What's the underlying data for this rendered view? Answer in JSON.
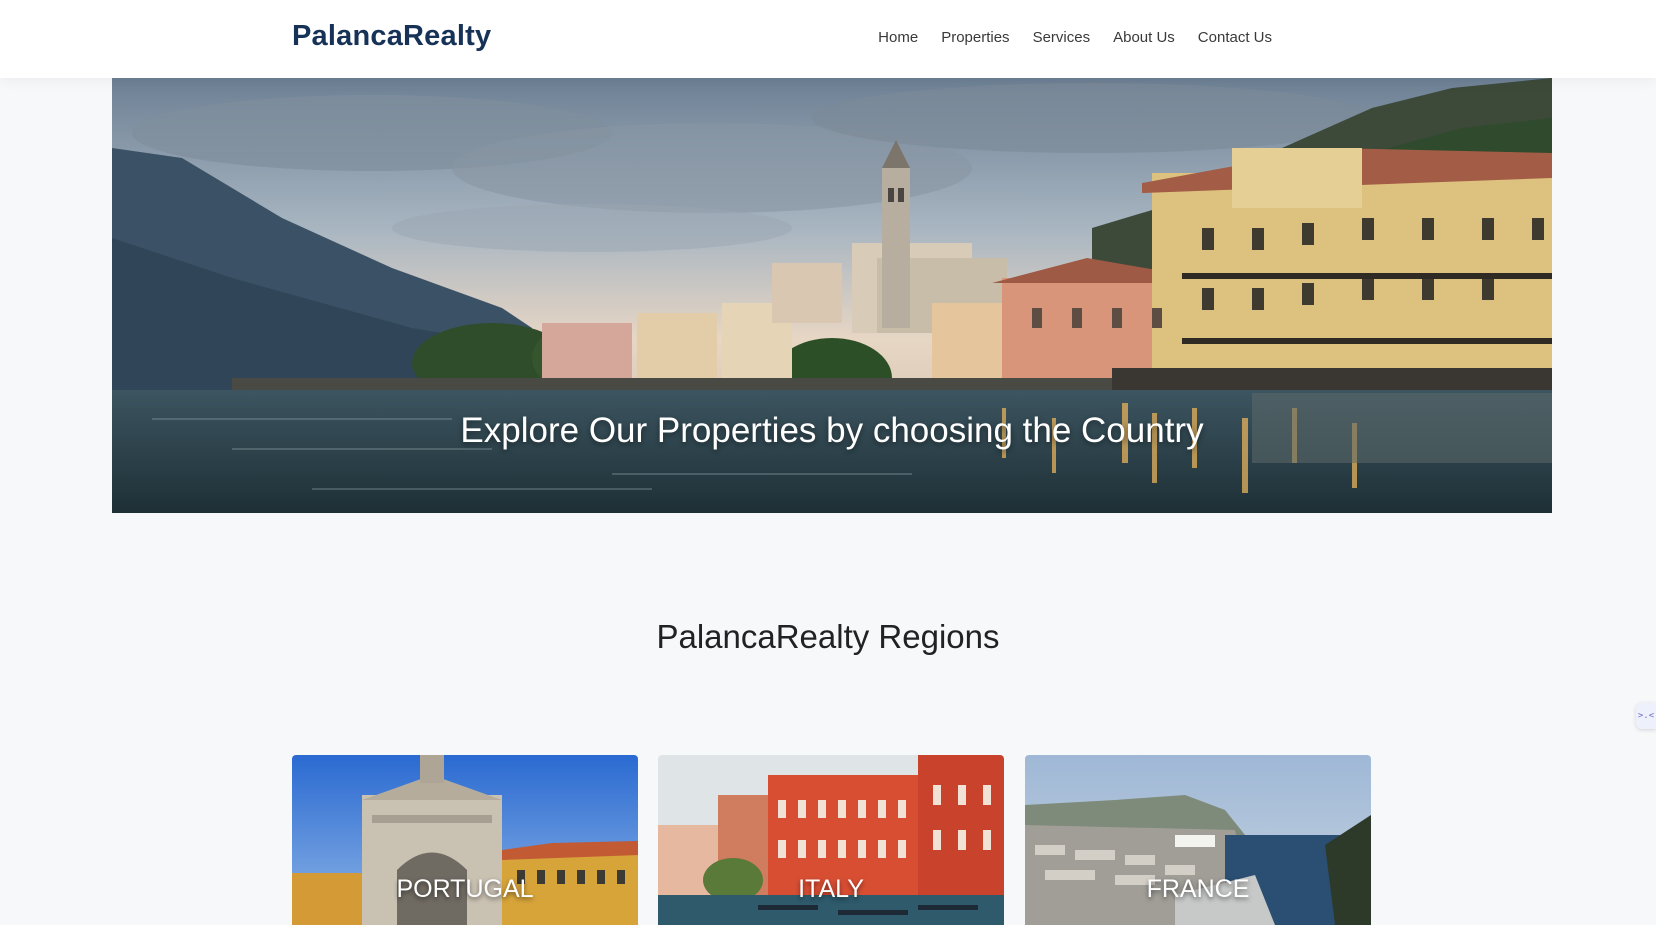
{
  "header": {
    "logo": "PalancaRealty",
    "nav": [
      "Home",
      "Properties",
      "Services",
      "About Us",
      "Contact Us"
    ]
  },
  "hero": {
    "title": "Explore Our Properties by choosing the Country"
  },
  "regions": {
    "title": "PalancaRealty Regions",
    "cards": [
      {
        "label": "PORTUGAL"
      },
      {
        "label": "ITALY"
      },
      {
        "label": "FRANCE"
      }
    ]
  },
  "side_widget": {
    "glyph": ">.<"
  },
  "colors": {
    "logo": "#163257",
    "page_background": "#f7f8fa",
    "header_background": "#ffffff"
  }
}
